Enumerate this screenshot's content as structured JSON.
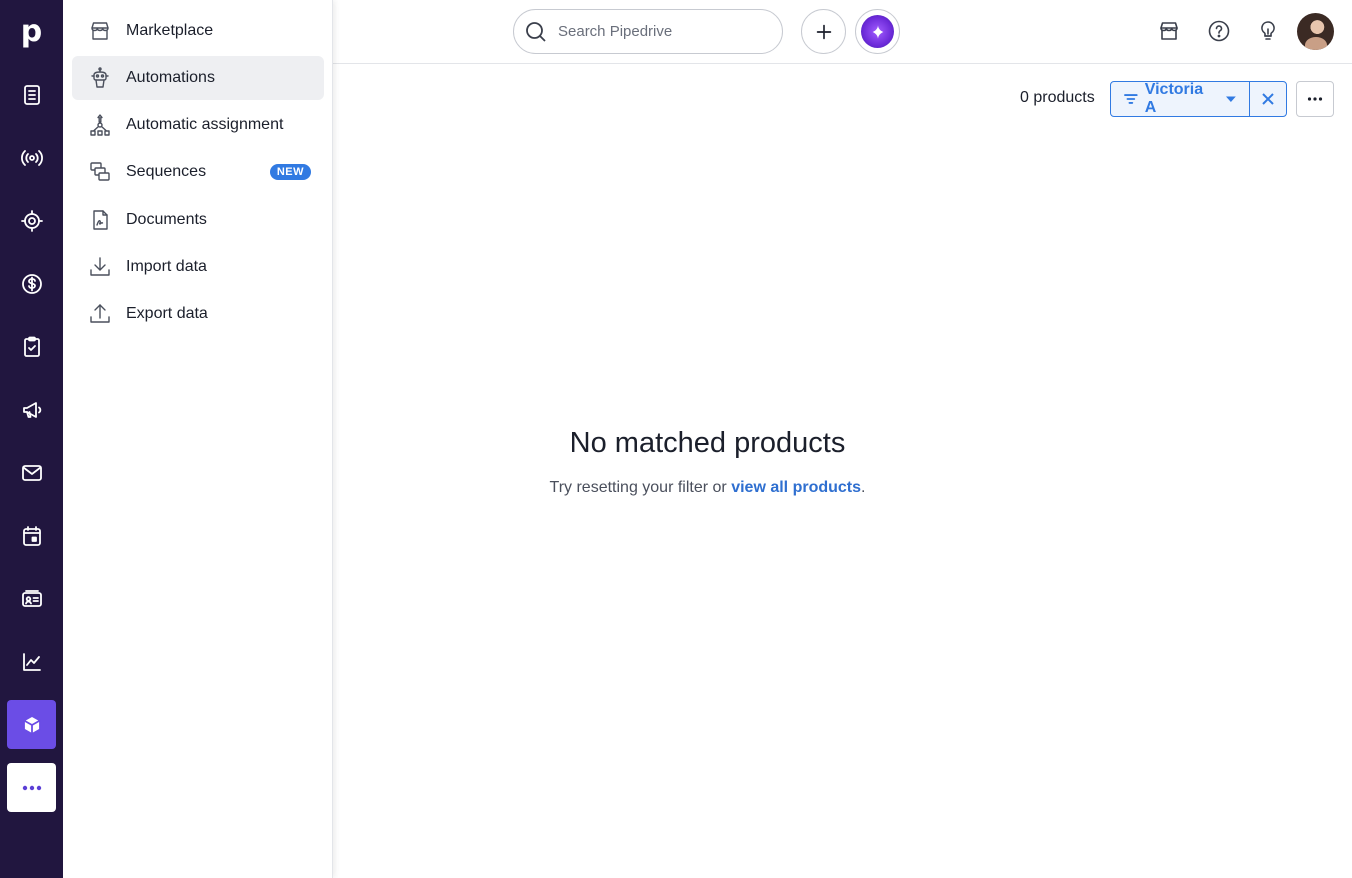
{
  "app": {
    "logo_letter": "p"
  },
  "rail": {
    "items": [
      {
        "icon": "leads-icon"
      },
      {
        "icon": "broadcast-icon"
      },
      {
        "icon": "target-icon"
      },
      {
        "icon": "dollar-icon"
      },
      {
        "icon": "clipboard-check-icon"
      },
      {
        "icon": "megaphone-icon"
      },
      {
        "icon": "mail-icon"
      },
      {
        "icon": "calendar-icon"
      },
      {
        "icon": "contact-card-icon"
      },
      {
        "icon": "chart-icon"
      },
      {
        "icon": "box-icon"
      },
      {
        "icon": "more-icon"
      }
    ]
  },
  "flyout": {
    "items": [
      {
        "label": "Marketplace",
        "icon": "store-icon"
      },
      {
        "label": "Automations",
        "icon": "robot-icon"
      },
      {
        "label": "Automatic assignment",
        "icon": "assignment-icon"
      },
      {
        "label": "Sequences",
        "icon": "sequences-icon",
        "badge": "NEW"
      },
      {
        "label": "Documents",
        "icon": "document-icon"
      },
      {
        "label": "Import data",
        "icon": "import-icon"
      },
      {
        "label": "Export data",
        "icon": "export-icon"
      }
    ]
  },
  "topbar": {
    "search_placeholder": "Search Pipedrive"
  },
  "toolbar": {
    "count_text": "0 products",
    "filter_name": "Victoria A"
  },
  "empty_state": {
    "title": "No matched products",
    "text_prefix": "Try resetting your filter or ",
    "link_text": "view all products",
    "text_suffix": "."
  },
  "colors": {
    "rail_bg": "#21163f",
    "accent": "#6b4de6",
    "link": "#317ae2"
  }
}
